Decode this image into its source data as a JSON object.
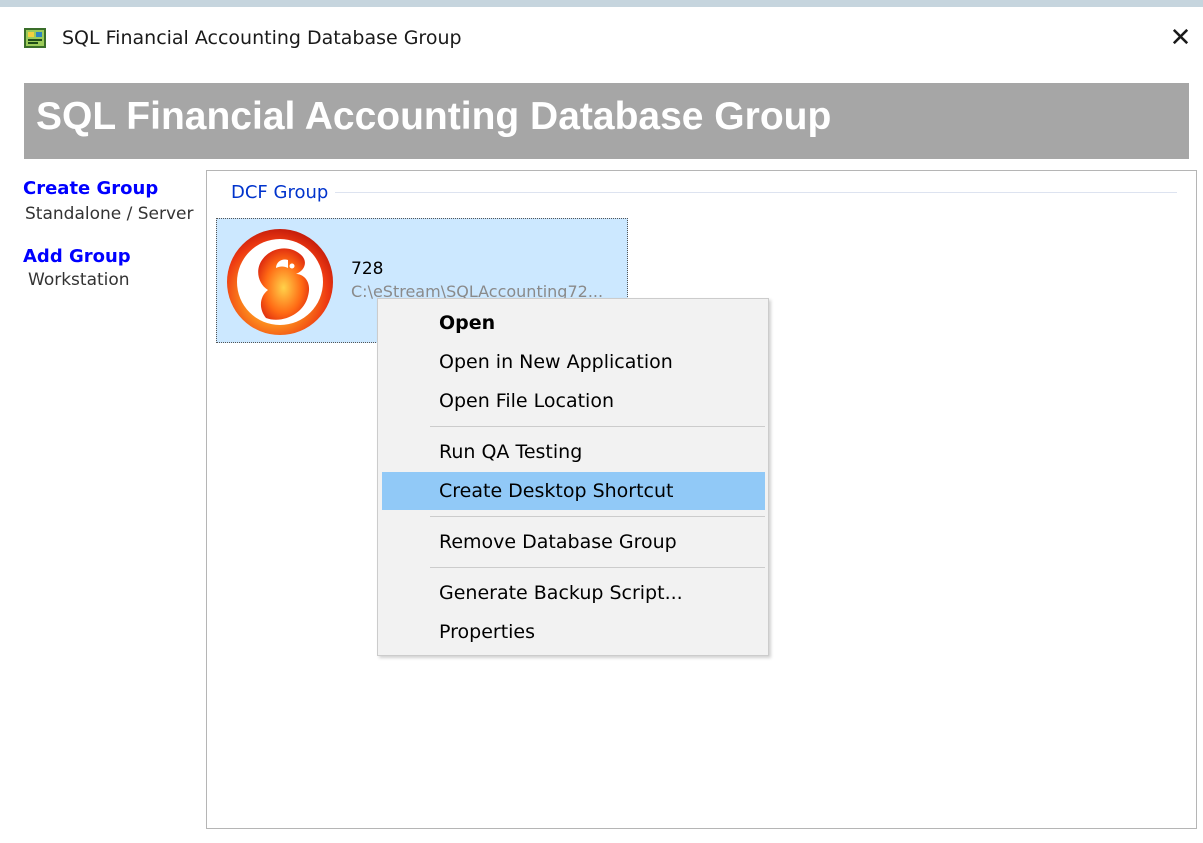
{
  "window": {
    "title": "SQL Financial Accounting Database Group",
    "close_glyph": "✕"
  },
  "banner": {
    "title": "SQL Financial Accounting Database Group"
  },
  "sidebar": {
    "create": {
      "label": "Create Group",
      "sub": "Standalone / Server"
    },
    "add": {
      "label": "Add Group",
      "sub": "Workstation"
    }
  },
  "group": {
    "name": "DCF Group",
    "items": [
      {
        "name": "728",
        "path": "C:\\eStream\\SQLAccounting72...",
        "icon": "firebird-icon"
      }
    ]
  },
  "context_menu": {
    "items": [
      {
        "label": "Open",
        "bold": true
      },
      {
        "label": "Open in New Application"
      },
      {
        "label": "Open File Location"
      },
      {
        "label": "Run QA Testing"
      },
      {
        "label": "Create Desktop Shortcut",
        "highlighted": true
      },
      {
        "label": "Remove Database Group"
      },
      {
        "label": "Generate Backup Script..."
      },
      {
        "label": "Properties"
      }
    ]
  },
  "colors": {
    "banner_bg": "#a6a6a6",
    "link": "#0000ff",
    "selection": "#cce8ff",
    "menu_highlight": "#91c9f7"
  }
}
